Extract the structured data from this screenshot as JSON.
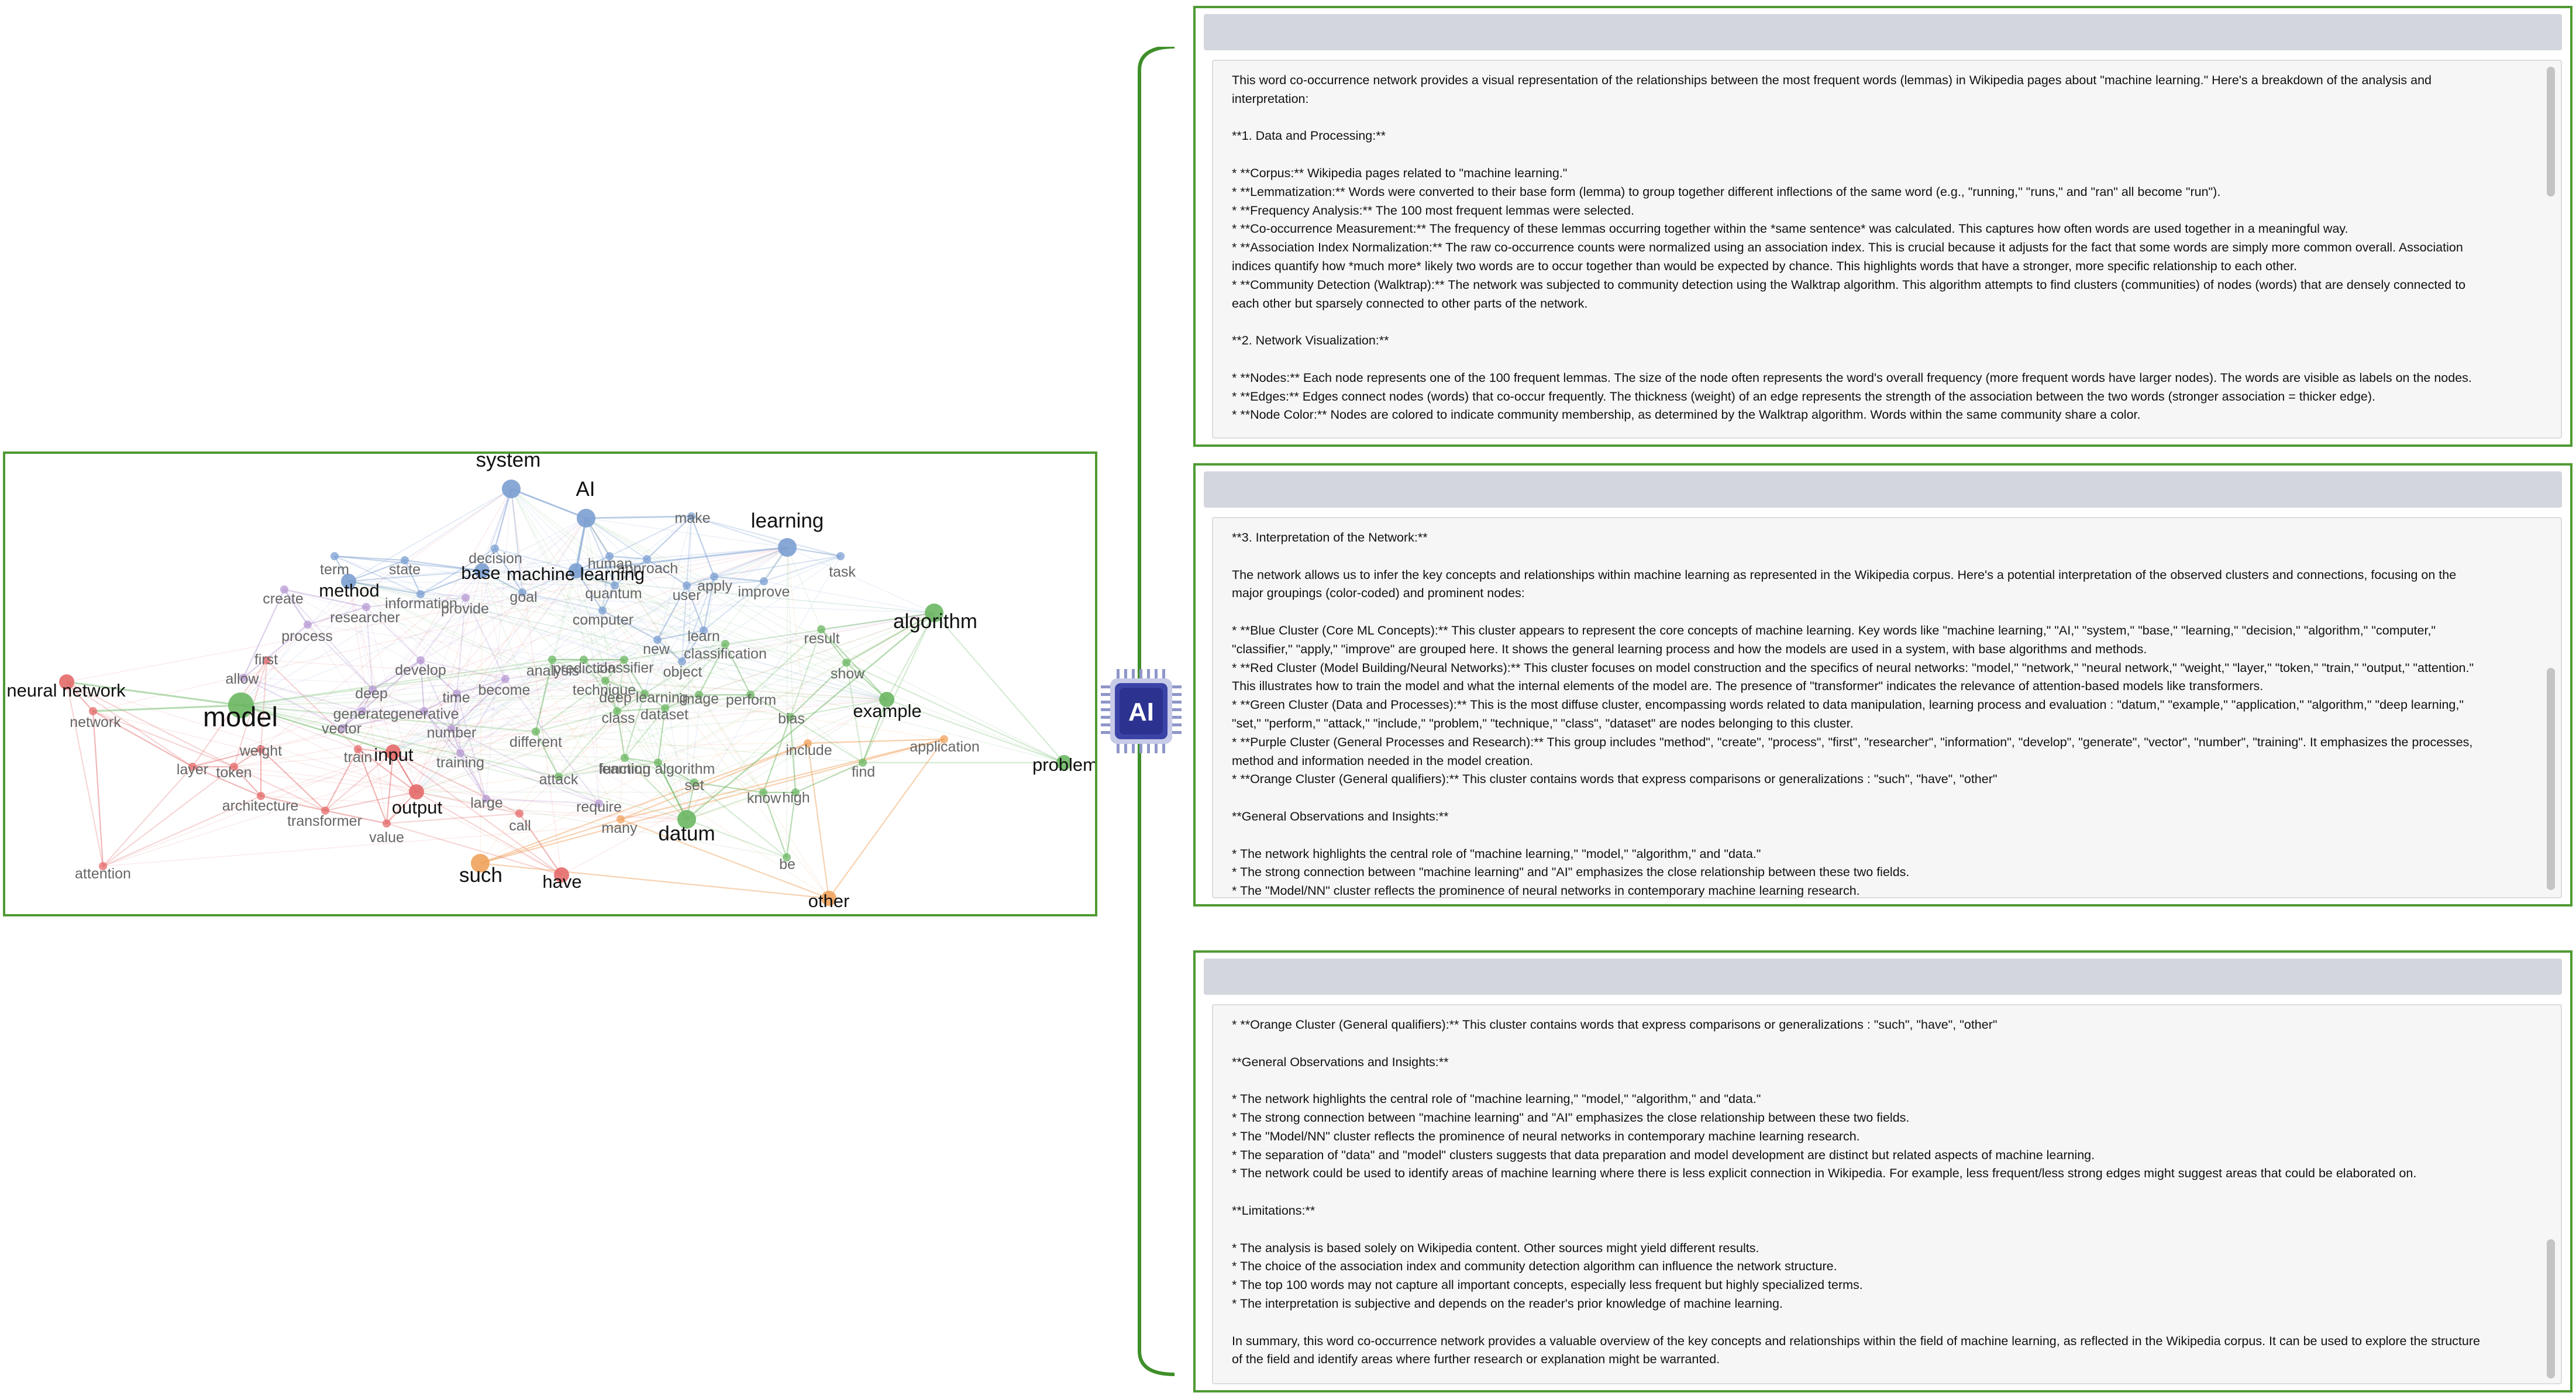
{
  "network": {
    "clusters": {
      "blue": "#7b9fd1",
      "red": "#e46a6a",
      "green": "#6cb763",
      "purple": "#b79ad3",
      "orange": "#f0a35c"
    },
    "nodes": [
      {
        "label": "system",
        "cluster": "blue",
        "size": "large"
      },
      {
        "label": "AI",
        "cluster": "blue",
        "size": "large"
      },
      {
        "label": "make",
        "cluster": "blue",
        "size": "small"
      },
      {
        "label": "learning",
        "cluster": "blue",
        "size": "large"
      },
      {
        "label": "decision",
        "cluster": "blue",
        "size": "small"
      },
      {
        "label": "human",
        "cluster": "blue",
        "size": "small"
      },
      {
        "label": "approach",
        "cluster": "blue",
        "size": "small"
      },
      {
        "label": "task",
        "cluster": "blue",
        "size": "small"
      },
      {
        "label": "term",
        "cluster": "blue",
        "size": "small"
      },
      {
        "label": "state",
        "cluster": "blue",
        "size": "small"
      },
      {
        "label": "base",
        "cluster": "blue",
        "size": "medium"
      },
      {
        "label": "machine learning",
        "cluster": "blue",
        "size": "medium"
      },
      {
        "label": "apply",
        "cluster": "blue",
        "size": "small"
      },
      {
        "label": "improve",
        "cluster": "blue",
        "size": "small"
      },
      {
        "label": "method",
        "cluster": "blue",
        "size": "medium"
      },
      {
        "label": "quantum",
        "cluster": "blue",
        "size": "small"
      },
      {
        "label": "user",
        "cluster": "blue",
        "size": "small"
      },
      {
        "label": "create",
        "cluster": "purple",
        "size": "small"
      },
      {
        "label": "information",
        "cluster": "blue",
        "size": "small"
      },
      {
        "label": "goal",
        "cluster": "blue",
        "size": "small"
      },
      {
        "label": "provide",
        "cluster": "purple",
        "size": "small"
      },
      {
        "label": "researcher",
        "cluster": "purple",
        "size": "small"
      },
      {
        "label": "computer",
        "cluster": "blue",
        "size": "small"
      },
      {
        "label": "algorithm",
        "cluster": "green",
        "size": "large"
      },
      {
        "label": "process",
        "cluster": "purple",
        "size": "small"
      },
      {
        "label": "learn",
        "cluster": "blue",
        "size": "small"
      },
      {
        "label": "result",
        "cluster": "green",
        "size": "small"
      },
      {
        "label": "new",
        "cluster": "blue",
        "size": "small"
      },
      {
        "label": "classification",
        "cluster": "green",
        "size": "small"
      },
      {
        "label": "first",
        "cluster": "red",
        "size": "small"
      },
      {
        "label": "develop",
        "cluster": "purple",
        "size": "small"
      },
      {
        "label": "analysis",
        "cluster": "green",
        "size": "small"
      },
      {
        "label": "prediction",
        "cluster": "green",
        "size": "small"
      },
      {
        "label": "classifier",
        "cluster": "green",
        "size": "small"
      },
      {
        "label": "object",
        "cluster": "blue",
        "size": "small"
      },
      {
        "label": "show",
        "cluster": "green",
        "size": "small"
      },
      {
        "label": "neural network",
        "cluster": "red",
        "size": "medium"
      },
      {
        "label": "allow",
        "cluster": "purple",
        "size": "small"
      },
      {
        "label": "become",
        "cluster": "purple",
        "size": "small"
      },
      {
        "label": "technique",
        "cluster": "green",
        "size": "small"
      },
      {
        "label": "deep",
        "cluster": "purple",
        "size": "small"
      },
      {
        "label": "time",
        "cluster": "purple",
        "size": "small"
      },
      {
        "label": "deep learning",
        "cluster": "green",
        "size": "small"
      },
      {
        "label": "image",
        "cluster": "green",
        "size": "small"
      },
      {
        "label": "perform",
        "cluster": "green",
        "size": "small"
      },
      {
        "label": "example",
        "cluster": "green",
        "size": "medium"
      },
      {
        "label": "network",
        "cluster": "red",
        "size": "small"
      },
      {
        "label": "model",
        "cluster": "green",
        "size": "xlarge"
      },
      {
        "label": "generate",
        "cluster": "purple",
        "size": "small"
      },
      {
        "label": "generative",
        "cluster": "purple",
        "size": "small"
      },
      {
        "label": "class",
        "cluster": "green",
        "size": "small"
      },
      {
        "label": "dataset",
        "cluster": "green",
        "size": "small"
      },
      {
        "label": "bias",
        "cluster": "green",
        "size": "small"
      },
      {
        "label": "vector",
        "cluster": "purple",
        "size": "small"
      },
      {
        "label": "number",
        "cluster": "purple",
        "size": "small"
      },
      {
        "label": "different",
        "cluster": "green",
        "size": "small"
      },
      {
        "label": "include",
        "cluster": "orange",
        "size": "small"
      },
      {
        "label": "application",
        "cluster": "orange",
        "size": "small"
      },
      {
        "label": "weight",
        "cluster": "red",
        "size": "small"
      },
      {
        "label": "train",
        "cluster": "red",
        "size": "small"
      },
      {
        "label": "input",
        "cluster": "red",
        "size": "medium"
      },
      {
        "label": "training",
        "cluster": "purple",
        "size": "small"
      },
      {
        "label": "function",
        "cluster": "green",
        "size": "small"
      },
      {
        "label": "learning algorithm",
        "cluster": "green",
        "size": "small"
      },
      {
        "label": "find",
        "cluster": "green",
        "size": "small"
      },
      {
        "label": "problem",
        "cluster": "green",
        "size": "medium"
      },
      {
        "label": "layer",
        "cluster": "red",
        "size": "small"
      },
      {
        "label": "token",
        "cluster": "red",
        "size": "small"
      },
      {
        "label": "attack",
        "cluster": "green",
        "size": "small"
      },
      {
        "label": "set",
        "cluster": "green",
        "size": "small"
      },
      {
        "label": "know",
        "cluster": "green",
        "size": "small"
      },
      {
        "label": "high",
        "cluster": "green",
        "size": "small"
      },
      {
        "label": "architecture",
        "cluster": "red",
        "size": "small"
      },
      {
        "label": "output",
        "cluster": "red",
        "size": "medium"
      },
      {
        "label": "large",
        "cluster": "purple",
        "size": "small"
      },
      {
        "label": "require",
        "cluster": "purple",
        "size": "small"
      },
      {
        "label": "transformer",
        "cluster": "red",
        "size": "small"
      },
      {
        "label": "call",
        "cluster": "red",
        "size": "small"
      },
      {
        "label": "many",
        "cluster": "orange",
        "size": "small"
      },
      {
        "label": "datum",
        "cluster": "green",
        "size": "large"
      },
      {
        "label": "value",
        "cluster": "red",
        "size": "small"
      },
      {
        "label": "be",
        "cluster": "green",
        "size": "small"
      },
      {
        "label": "attention",
        "cluster": "red",
        "size": "small"
      },
      {
        "label": "such",
        "cluster": "orange",
        "size": "large"
      },
      {
        "label": "have",
        "cluster": "red",
        "size": "medium"
      },
      {
        "label": "other",
        "cluster": "orange",
        "size": "medium"
      }
    ]
  },
  "ai_chip": {
    "label": "AI",
    "icon": "ai-chip-icon"
  },
  "panels": [
    {
      "lines": [
        "This word co-occurrence network provides a visual representation of the relationships between the most frequent words (lemmas) in Wikipedia pages about \"machine learning.\"  Here's a breakdown of the analysis and",
        "interpretation:",
        "",
        "**1. Data and Processing:**",
        "",
        "*   **Corpus:** Wikipedia pages related to \"machine learning.\"",
        "*   **Lemmatization:** Words were converted to their base form (lemma) to group together different inflections of the same word (e.g., \"running,\" \"runs,\" and \"ran\" all become \"run\").",
        "*   **Frequency Analysis:**  The 100 most frequent lemmas were selected.",
        "*   **Co-occurrence Measurement:**  The frequency of these lemmas occurring together within the *same sentence* was calculated.  This captures how often words are used together in a meaningful way.",
        "*   **Association Index Normalization:** The raw co-occurrence counts were normalized using an association index. This is crucial because it adjusts for the fact that some words are simply more common overall. Association",
        "indices quantify how *much more* likely two words are to occur together than would be expected by chance.  This highlights words that have a stronger, more specific relationship to each other.",
        "*   **Community Detection (Walktrap):** The network was subjected to community detection using the Walktrap algorithm. This algorithm attempts to find clusters (communities) of nodes (words) that are densely connected to",
        "each other but sparsely connected to other parts of the network.",
        "",
        "**2. Network Visualization:**",
        "",
        "*   **Nodes:**  Each node represents one of the 100 frequent lemmas.  The size of the node often represents the word's overall frequency (more frequent words have larger nodes). The words are visible as labels on the nodes.",
        "*   **Edges:**  Edges connect nodes (words) that co-occur frequently. The thickness (weight) of an edge represents the strength of the association between the two words (stronger association = thicker edge).",
        "*   **Node Color:** Nodes are colored to indicate community membership, as determined by the Walktrap algorithm.  Words within the same community share a color."
      ]
    },
    {
      "lines": [
        "**3. Interpretation of the Network:**",
        "",
        "The network allows us to infer the key concepts and relationships within machine learning as represented in the Wikipedia corpus. Here's a potential interpretation of the observed clusters and connections, focusing on the",
        "major groupings (color-coded) and prominent nodes:",
        "",
        "*   **Blue Cluster (Core ML Concepts):** This cluster appears to represent the core concepts of machine learning.  Key words like \"machine learning,\" \"AI,\" \"system,\" \"base,\" \"learning,\" \"decision,\" \"algorithm,\" \"computer,\"",
        "\"classifier,\" \"apply,\" \"improve\" are grouped here.  It shows the general learning process and how the models are used in a system, with base algorithms and methods.",
        "*   **Red Cluster (Model Building/Neural Networks):**  This cluster focuses on model construction and the specifics of neural networks: \"model,\" \"network,\" \"neural network,\" \"weight,\" \"layer,\" \"token,\" \"train,\" \"output,\" \"attention.\"",
        "This illustrates how to train the model and what the internal elements of the model are. The presence of \"transformer\" indicates the relevance of attention-based models like transformers.",
        "*   **Green Cluster (Data and Processes):** This is the most diffuse cluster, encompassing words related to data manipulation, learning process and evaluation : \"datum,\" \"example,\" \"application,\" \"algorithm,\" \"deep learning,\"",
        "\"set,\" \"perform,\" \"attack,\" \"include,\" \"problem,\" \"technique,\" \"class\", \"dataset\" are nodes belonging to this cluster.",
        "*   **Purple Cluster (General Processes and Research):**  This group includes \"method\", \"create\", \"process\", \"first\", \"researcher\", \"information\", \"develop\", \"generate\", \"vector\", \"number\", \"training\". It emphasizes the processes,",
        "method and information needed in the model creation.",
        "*   **Orange Cluster (General qualifiers):**  This cluster contains words that express comparisons or generalizations : \"such\", \"have\", \"other\"",
        "",
        "**General Observations and Insights:**",
        "",
        "*   The network highlights the central role of \"machine learning,\" \"model,\" \"algorithm,\" and \"data.\"",
        "*   The strong connection between \"machine learning\" and \"AI\" emphasizes the close relationship between these two fields.",
        "*   The \"Model/NN\" cluster reflects the prominence of neural networks in contemporary machine learning research."
      ]
    },
    {
      "lines": [
        "*   **Orange Cluster (General qualifiers):**  This cluster contains words that express comparisons or generalizations : \"such\", \"have\", \"other\"",
        "",
        "**General Observations and Insights:**",
        "",
        "*   The network highlights the central role of \"machine learning,\" \"model,\" \"algorithm,\" and \"data.\"",
        "*   The strong connection between \"machine learning\" and \"AI\" emphasizes the close relationship between these two fields.",
        "*   The \"Model/NN\" cluster reflects the prominence of neural networks in contemporary machine learning research.",
        "*   The separation of \"data\" and \"model\" clusters suggests that data preparation and model development are distinct but related aspects of machine learning.",
        "*   The network could be used to identify areas of machine learning where there is less explicit connection in Wikipedia. For example, less frequent/less strong edges might suggest areas that could be elaborated on.",
        "",
        "**Limitations:**",
        "",
        "*   The analysis is based solely on Wikipedia content. Other sources might yield different results.",
        "*   The choice of the association index and community detection algorithm can influence the network structure.",
        "*   The top 100 words may not capture all important concepts, especially less frequent but highly specialized terms.",
        "*   The interpretation is subjective and depends on the reader's prior knowledge of machine learning.",
        "",
        "In summary, this word co-occurrence network provides a valuable overview of the key concepts and relationships within the field of machine learning, as reflected in the Wikipedia corpus. It can be used to explore the structure",
        "of the field and identify areas where further research or explanation might be warranted."
      ]
    }
  ]
}
